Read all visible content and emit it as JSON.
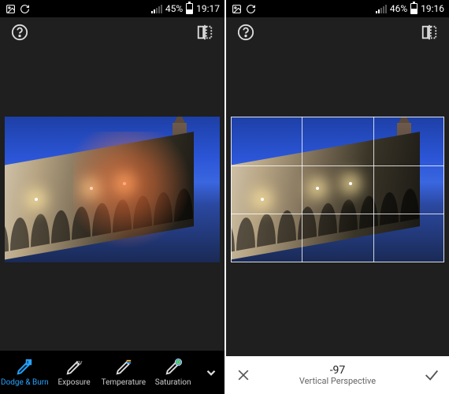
{
  "left": {
    "status": {
      "battery_pct": "45%",
      "time": "19:17",
      "signal_filled": 2
    },
    "tools": [
      {
        "label": "Dodge & Burn",
        "icon": "brush-db",
        "active": true
      },
      {
        "label": "Exposure",
        "icon": "brush-ev",
        "active": false,
        "badge": "EV"
      },
      {
        "label": "Temperature",
        "icon": "brush-temp",
        "active": false
      },
      {
        "label": "Saturation",
        "icon": "brush-sat",
        "active": false
      }
    ]
  },
  "right": {
    "status": {
      "battery_pct": "46%",
      "time": "19:16",
      "signal_filled": 2
    },
    "adjust": {
      "value": "-97",
      "label": "Vertical Perspective"
    }
  },
  "icons": {
    "help": "help-icon",
    "compare": "compare-icon",
    "cancel": "close-icon",
    "confirm": "check-icon",
    "more": "chevron-down-icon"
  }
}
